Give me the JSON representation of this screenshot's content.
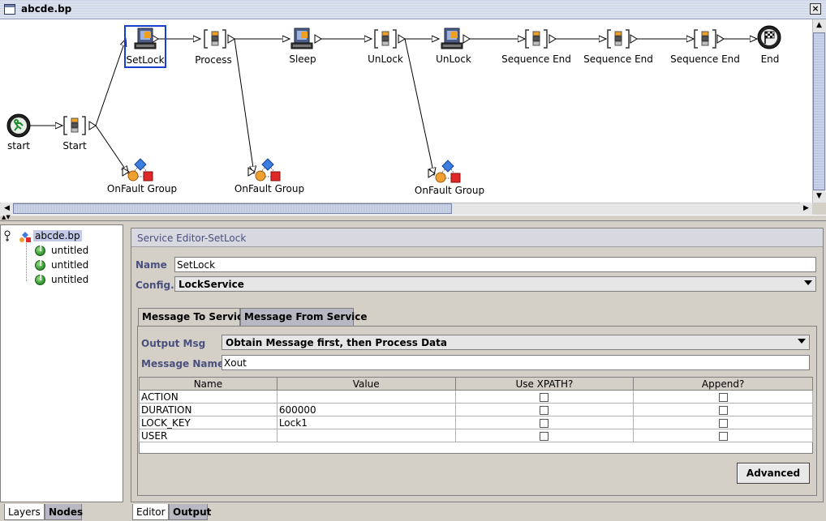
{
  "window": {
    "title": "abcde.bp",
    "close_icon": "×"
  },
  "diagram": {
    "nodes": [
      {
        "id": "start",
        "label": "start",
        "icon": "running-person-icon"
      },
      {
        "id": "Start",
        "label": "Start",
        "icon": "sequence-icon"
      },
      {
        "id": "SetLock",
        "label": "SetLock",
        "icon": "service-computer-icon",
        "selected": true
      },
      {
        "id": "Process",
        "label": "Process",
        "icon": "sequence-icon"
      },
      {
        "id": "Sleep",
        "label": "Sleep",
        "icon": "service-computer-icon"
      },
      {
        "id": "UnLock1",
        "label": "UnLock",
        "icon": "sequence-icon"
      },
      {
        "id": "UnLock2",
        "label": "UnLock",
        "icon": "service-computer-icon"
      },
      {
        "id": "SeqEnd1",
        "label": "Sequence End",
        "icon": "sequence-icon"
      },
      {
        "id": "SeqEnd2",
        "label": "Sequence End",
        "icon": "sequence-icon"
      },
      {
        "id": "SeqEnd3",
        "label": "Sequence End",
        "icon": "sequence-icon"
      },
      {
        "id": "End",
        "label": "End",
        "icon": "checkered-flag-icon"
      },
      {
        "id": "OnFault1",
        "label": "OnFault Group",
        "icon": "fault-group-icon"
      },
      {
        "id": "OnFault2",
        "label": "OnFault Group",
        "icon": "fault-group-icon"
      },
      {
        "id": "OnFault3",
        "label": "OnFault Group",
        "icon": "fault-group-icon"
      }
    ]
  },
  "tree": {
    "root": "abcde.bp",
    "children": [
      "untitled",
      "untitled",
      "untitled"
    ]
  },
  "left_tabs": [
    "Layers",
    "Nodes"
  ],
  "bottom_tabs": [
    "Editor",
    "Output"
  ],
  "editor": {
    "title": "Service Editor-SetLock",
    "name_label": "Name",
    "name_value": "SetLock",
    "config_label": "Config.",
    "config_value": "LockService",
    "tabs": [
      "Message To Service",
      "Message From Service"
    ],
    "output_msg_label": "Output Msg",
    "output_msg_value": "Obtain Message first, then Process Data",
    "message_name_label": "Message Name",
    "message_name_value": "Xout",
    "table": {
      "columns": [
        "Name",
        "Value",
        "Use XPATH?",
        "Append?"
      ],
      "rows": [
        {
          "name": "ACTION",
          "value": "",
          "xpath": false,
          "append": false
        },
        {
          "name": "DURATION",
          "value": "600000",
          "xpath": false,
          "append": false
        },
        {
          "name": "LOCK_KEY",
          "value": "Lock1",
          "xpath": false,
          "append": false
        },
        {
          "name": "USER",
          "value": "",
          "xpath": false,
          "append": false
        }
      ]
    },
    "advanced_button": "Advanced"
  },
  "colors": {
    "accent_label": "#4a4f7e",
    "selection": "#1a3fd0",
    "fault_orange": "#f0a030",
    "fault_red": "#e02828",
    "fault_blue": "#3a7ee0"
  }
}
